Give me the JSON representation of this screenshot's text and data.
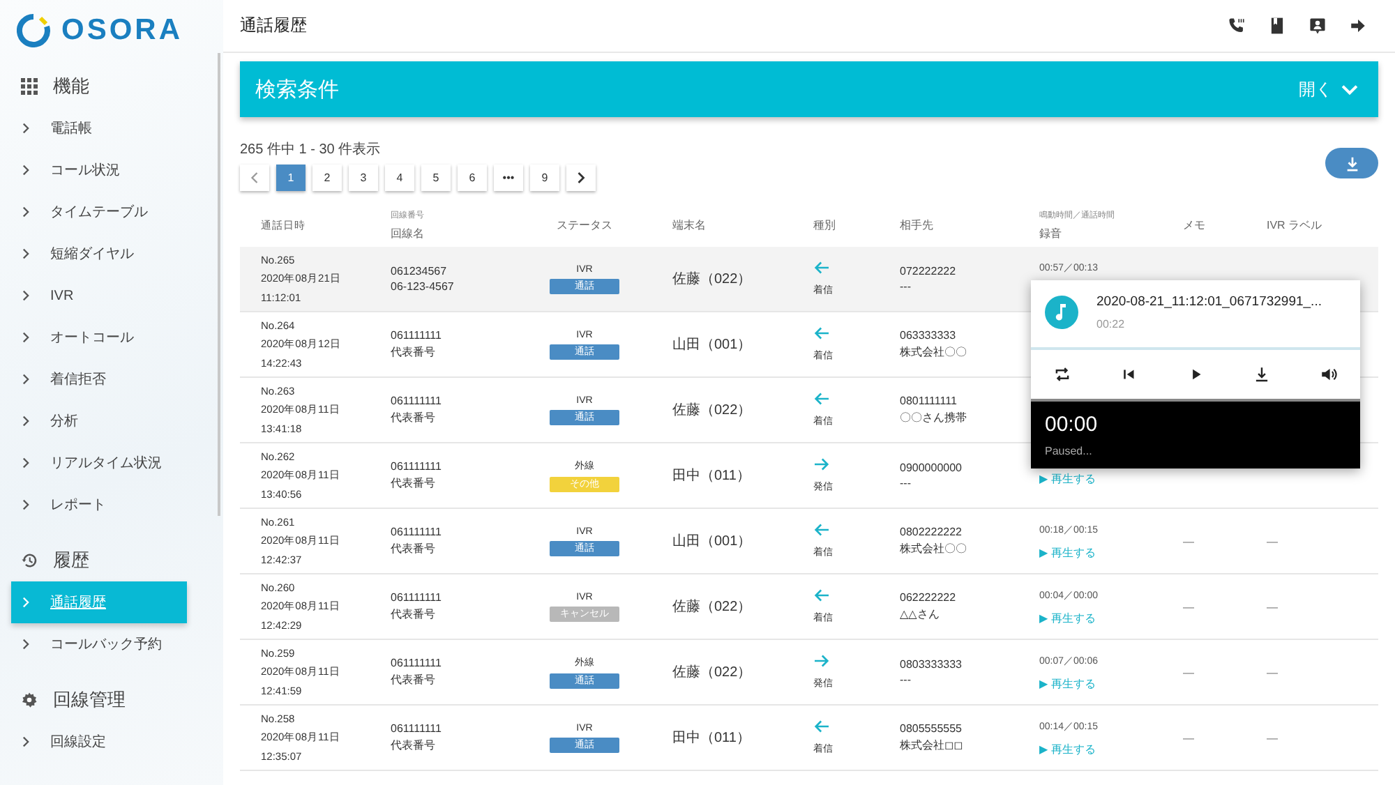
{
  "brand": {
    "name": "OSORA"
  },
  "sidebar": {
    "sections": [
      {
        "kind": "grid",
        "title": "機能",
        "items": [
          {
            "label": "電話帳",
            "selected": false
          },
          {
            "label": "コール状況",
            "selected": false
          },
          {
            "label": "タイムテーブル",
            "selected": false
          },
          {
            "label": "短縮ダイヤル",
            "selected": false
          },
          {
            "label": "IVR",
            "selected": false
          },
          {
            "label": "オートコール",
            "selected": false
          },
          {
            "label": "着信拒否",
            "selected": false
          },
          {
            "label": "分析",
            "selected": false
          },
          {
            "label": "リアルタイム状況",
            "selected": false
          },
          {
            "label": "レポート",
            "selected": false
          }
        ]
      },
      {
        "kind": "history",
        "title": "履歴",
        "items": [
          {
            "label": "通話履歴",
            "selected": true
          },
          {
            "label": "コールバック予約",
            "selected": false
          }
        ]
      },
      {
        "kind": "gear",
        "title": "回線管理",
        "items": [
          {
            "label": "回線設定",
            "selected": false
          }
        ]
      }
    ]
  },
  "header": {
    "title": "通話履歴"
  },
  "search_panel": {
    "title": "検索条件",
    "toggle": "開く",
    "expanded": false
  },
  "summary": "265 件中 1 - 30 件表示",
  "pagination": [
    {
      "label": "1",
      "selected": true
    },
    {
      "label": "2",
      "selected": false
    },
    {
      "label": "3",
      "selected": false
    },
    {
      "label": "4",
      "selected": false
    },
    {
      "label": "5",
      "selected": false
    },
    {
      "label": "6",
      "selected": false
    },
    {
      "label": "•••",
      "selected": false
    },
    {
      "label": "9",
      "selected": false
    }
  ],
  "table": {
    "columns": [
      {
        "label": "通話日時"
      },
      {
        "sub": "回線番号",
        "label": "回線名"
      },
      {
        "label": "ステータス"
      },
      {
        "label": "端末名"
      },
      {
        "label": "種別"
      },
      {
        "label": "相手先"
      },
      {
        "sub": "鳴動時間／通話時間",
        "label": "録音"
      },
      {
        "label": "メモ"
      },
      {
        "label": "IVR ラベル"
      }
    ],
    "rows": [
      {
        "selected": true,
        "no": "No.265",
        "date": "2020年08月21日",
        "time": "11:12:01",
        "line_number": "061234567",
        "line_name": "06-123-4567",
        "route": "IVR",
        "status": {
          "label": "通話",
          "color": "#4a8cc4"
        },
        "terminal": "佐藤（022）",
        "direction": {
          "kind": "incoming",
          "label": "着信"
        },
        "partner_number": "072222222",
        "partner_name": "---",
        "durations": "00:57／00:13"
      },
      {
        "selected": false,
        "no": "No.264",
        "date": "2020年08月12日",
        "time": "14:22:43",
        "line_number": "061111111",
        "line_name": "代表番号",
        "route": "IVR",
        "status": {
          "label": "通話",
          "color": "#4a8cc4"
        },
        "terminal": "山田（001）",
        "direction": {
          "kind": "incoming",
          "label": "着信"
        },
        "partner_number": "063333333",
        "partner_name": "株式会社〇〇"
      },
      {
        "selected": false,
        "no": "No.263",
        "date": "2020年08月11日",
        "time": "13:41:18",
        "line_number": "061111111",
        "line_name": "代表番号",
        "route": "IVR",
        "status": {
          "label": "通話",
          "color": "#4a8cc4"
        },
        "terminal": "佐藤（022）",
        "direction": {
          "kind": "incoming",
          "label": "着信"
        },
        "partner_number": "0801111111",
        "partner_name": "〇〇さん携帯"
      },
      {
        "selected": false,
        "no": "No.262",
        "date": "2020年08月11日",
        "time": "13:40:56",
        "line_number": "061111111",
        "line_name": "代表番号",
        "route": "外線",
        "status": {
          "label": "その他",
          "color": "#f2d23c"
        },
        "terminal": "田中（011）",
        "direction": {
          "kind": "outgoing",
          "label": "発信"
        },
        "partner_number": "0900000000",
        "partner_name": "---",
        "play": "▶ 再生する"
      },
      {
        "selected": false,
        "no": "No.261",
        "date": "2020年08月11日",
        "time": "12:42:37",
        "line_number": "061111111",
        "line_name": "代表番号",
        "route": "IVR",
        "status": {
          "label": "通話",
          "color": "#4a8cc4"
        },
        "terminal": "山田（001）",
        "direction": {
          "kind": "incoming",
          "label": "着信"
        },
        "partner_number": "0802222222",
        "partner_name": "株式会社〇〇",
        "durations": "00:18／00:15",
        "play": "▶ 再生する",
        "memo": "—",
        "ivr_label": "—"
      },
      {
        "selected": false,
        "no": "No.260",
        "date": "2020年08月11日",
        "time": "12:42:29",
        "line_number": "061111111",
        "line_name": "代表番号",
        "route": "IVR",
        "status": {
          "label": "キャンセル",
          "color": "#b8b8b8"
        },
        "terminal": "佐藤（022）",
        "direction": {
          "kind": "incoming",
          "label": "着信"
        },
        "partner_number": "062222222",
        "partner_name": "△△さん",
        "durations": "00:04／00:00",
        "play": "▶ 再生する",
        "memo": "—",
        "ivr_label": "—"
      },
      {
        "selected": false,
        "no": "No.259",
        "date": "2020年08月11日",
        "time": "12:41:59",
        "line_number": "061111111",
        "line_name": "代表番号",
        "route": "外線",
        "status": {
          "label": "通話",
          "color": "#4a8cc4"
        },
        "terminal": "佐藤（022）",
        "direction": {
          "kind": "outgoing",
          "label": "発信"
        },
        "partner_number": "0803333333",
        "partner_name": "---",
        "durations": "00:07／00:06",
        "play": "▶ 再生する",
        "memo": "—",
        "ivr_label": "—"
      },
      {
        "selected": false,
        "no": "No.258",
        "date": "2020年08月11日",
        "time": "12:35:07",
        "line_number": "061111111",
        "line_name": "代表番号",
        "route": "IVR",
        "status": {
          "label": "通話",
          "color": "#4a8cc4"
        },
        "terminal": "田中（011）",
        "direction": {
          "kind": "incoming",
          "label": "着信"
        },
        "partner_number": "0805555555",
        "partner_name": "株式会社◻◻",
        "durations": "00:14／00:15",
        "play": "▶ 再生する",
        "memo": "—",
        "ivr_label": "—"
      }
    ]
  },
  "player": {
    "filename": "2020-08-21_11:12:01_0671732991_...",
    "duration": "00:22",
    "current": "00:00",
    "state": "Paused..."
  }
}
